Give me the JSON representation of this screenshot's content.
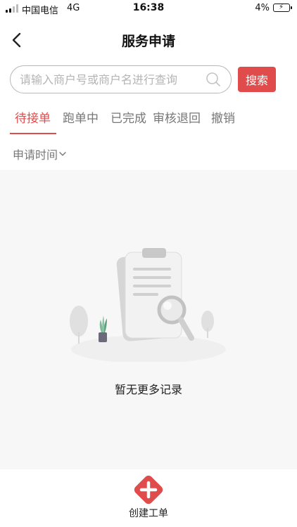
{
  "status_bar": {
    "carrier": "中国电信",
    "network": "4G",
    "time": "16:38",
    "battery": "4%"
  },
  "nav": {
    "title": "服务申请",
    "back_icon": "chevron-left-icon"
  },
  "search": {
    "placeholder": "请输入商户号或商户名进行查询",
    "value": "",
    "button_label": "搜索"
  },
  "tabs": [
    {
      "label": "待接单",
      "active": true
    },
    {
      "label": "跑单中",
      "active": false
    },
    {
      "label": "已完成",
      "active": false
    },
    {
      "label": "审核退回",
      "active": false
    },
    {
      "label": "撤销",
      "active": false
    }
  ],
  "filter": {
    "label": "申请时间"
  },
  "empty_state": {
    "message": "暂无更多记录"
  },
  "bottom": {
    "create_label": "创建工单"
  },
  "colors": {
    "accent": "#e04b4b",
    "background": "#f7f7f7"
  }
}
